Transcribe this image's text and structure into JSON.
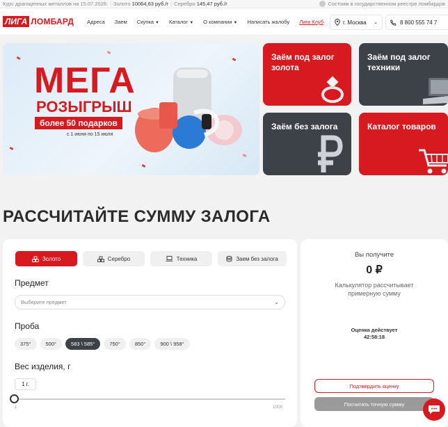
{
  "topbar": {
    "rates_label": "Курс драгоценных металлов на 15.07.2026:",
    "gold_label": "Золото",
    "gold_value": "10064,63 руб./г",
    "silver_label": "Серебро",
    "silver_value": "145,47 руб./г",
    "registry_text": "Состоим в государственном реестре ломбардов"
  },
  "logo": {
    "part1": "ЛИГА",
    "part2": "ЛОМБАРД"
  },
  "nav": {
    "items": [
      "Адреса",
      "Заем",
      "Скупка",
      "Каталог",
      "О компании",
      "Написать жалобу",
      "Лига Клуб"
    ],
    "city": "г. Москва",
    "phone": "8 800 555 74 7"
  },
  "banner": {
    "title": "МЕГА",
    "subtitle": "РОЗЫГРЫШ",
    "gifts": "более 50 подарков",
    "dates": "с 1 июня по 15 июля"
  },
  "tiles": [
    {
      "label": "Заём под залог золота"
    },
    {
      "label": "Заём под залог техники"
    },
    {
      "label": "Заём без залога"
    },
    {
      "label": "Каталог товаров"
    }
  ],
  "heading": "РАССЧИТАЙТЕ СУММУ ЗАЛОГА",
  "calc": {
    "tabs": [
      "Золото",
      "Серебро",
      "Техника",
      "Заем без залога"
    ],
    "item_label": "Предмет",
    "item_placeholder": "Выберите предмет",
    "probe_label": "Проба",
    "probes": [
      "375°",
      "500°",
      "583 \\ 585°",
      "750°",
      "850°",
      "900 \\ 958°"
    ],
    "weight_label": "Вес изделия, г",
    "weight_value": "1 г.",
    "slider_min": "1",
    "slider_max": "1000"
  },
  "result": {
    "you_get": "Вы получите",
    "amount": "0 ₽",
    "note": "Калькулятор рассчитывает примерную сумму",
    "valid_label": "Оценка действует",
    "timer": "42:58:18",
    "confirm_btn": "Подтвердить оценку",
    "exact_btn": "Посчитать точную сумму"
  },
  "colors": {
    "brand_red": "#d71920",
    "dark_tile": "#3d4148"
  }
}
